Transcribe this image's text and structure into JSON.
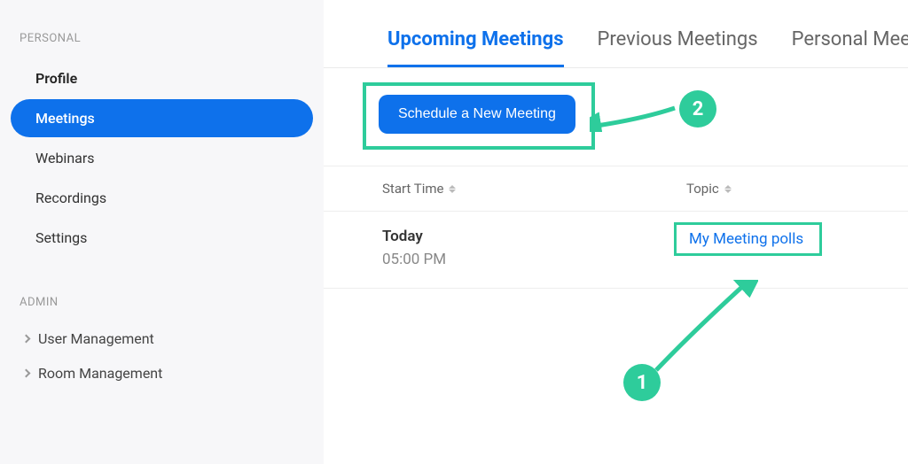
{
  "sidebar": {
    "personal_header": "PERSONAL",
    "items": [
      {
        "label": "Profile"
      },
      {
        "label": "Meetings"
      },
      {
        "label": "Webinars"
      },
      {
        "label": "Recordings"
      },
      {
        "label": "Settings"
      }
    ],
    "admin_header": "ADMIN",
    "admin_items": [
      {
        "label": "User Management"
      },
      {
        "label": "Room Management"
      }
    ]
  },
  "tabs": {
    "upcoming": "Upcoming Meetings",
    "previous": "Previous Meetings",
    "personal": "Personal Meeting Room"
  },
  "schedule_button": "Schedule a New Meeting",
  "table": {
    "headers": {
      "start_time": "Start Time",
      "topic": "Topic"
    },
    "row": {
      "day": "Today",
      "time": "05:00 PM",
      "topic": "My Meeting polls"
    }
  },
  "annotations": {
    "one": "1",
    "two": "2"
  },
  "colors": {
    "primary": "#0E71EB",
    "highlight": "#2ECC9B"
  }
}
